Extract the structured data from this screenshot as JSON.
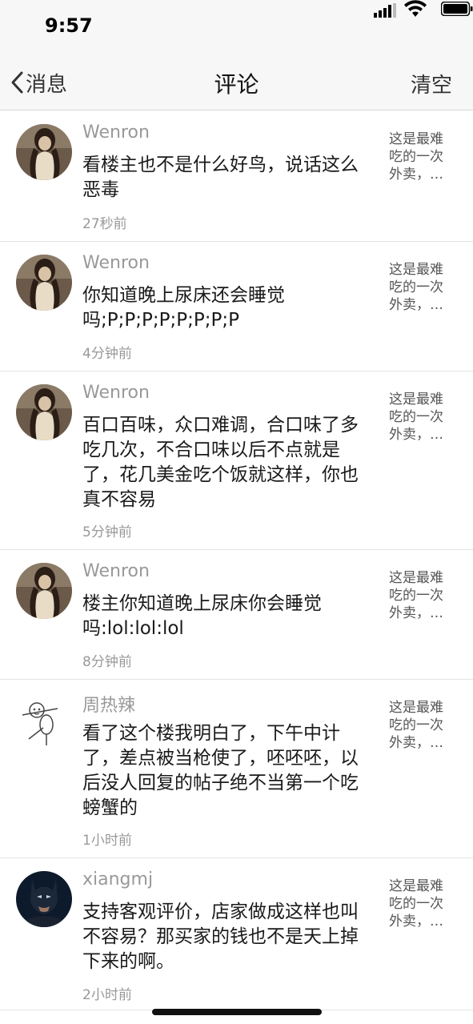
{
  "status_bar": {
    "time": "9:57"
  },
  "nav": {
    "back_label": "消息",
    "title": "评论",
    "clear_label": "清空"
  },
  "comments": [
    {
      "author": "Wenron",
      "text": "看楼主也不是什么好鸟，说话这么恶毒",
      "time": "27秒前",
      "post_snippet": "这是最难吃的一次外卖，…",
      "avatar": "woman-photo-avatar"
    },
    {
      "author": "Wenron",
      "text": "你知道晚上尿床还会睡觉吗;P;P;P;P;P;P;P;P",
      "time": "4分钟前",
      "post_snippet": "这是最难吃的一次外卖，…",
      "avatar": "woman-photo-avatar"
    },
    {
      "author": "Wenron",
      "text": "百口百味，众口难调，合口味了多吃几次，不合口味以后不点就是了，花几美金吃个饭就这样，你也真不容易",
      "time": "5分钟前",
      "post_snippet": "这是最难吃的一次外卖，…",
      "avatar": "woman-photo-avatar"
    },
    {
      "author": "Wenron",
      "text": "楼主你知道晚上尿床你会睡觉吗:lol:lol:lol",
      "time": "8分钟前",
      "post_snippet": "这是最难吃的一次外卖，…",
      "avatar": "woman-photo-avatar"
    },
    {
      "author": "周热辣",
      "text": "看了这个楼我明白了，下午中计了，差点被当枪使了，呸呸呸，以后没人回复的帖子绝不当第一个吃螃蟹的",
      "time": "1小时前",
      "post_snippet": "这是最难吃的一次外卖，…",
      "avatar": "stick-figure-avatar"
    },
    {
      "author": "xiangmj",
      "text": "支持客观评价，店家做成这样也叫不容易？那买家的钱也不是天上掉下来的啊。",
      "time": "2小时前",
      "post_snippet": "这是最难吃的一次外卖，…",
      "avatar": "batman-avatar"
    }
  ]
}
